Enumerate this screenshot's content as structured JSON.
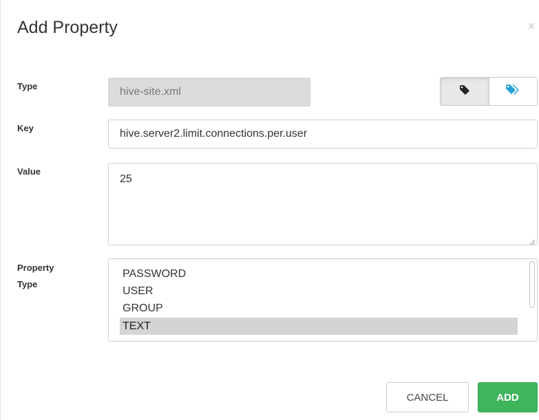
{
  "dialog": {
    "title": "Add Property",
    "close_glyph": "×"
  },
  "form": {
    "type": {
      "label": "Type",
      "value": "hive-site.xml"
    },
    "key": {
      "label": "Key",
      "value": "hive.server2.limit.connections.per.user"
    },
    "value": {
      "label": "Value",
      "value": "25"
    },
    "property_type": {
      "label_line1": "Property",
      "label_line2": "Type",
      "options": [
        "PASSWORD",
        "USER",
        "GROUP",
        "TEXT"
      ],
      "selected": "TEXT"
    }
  },
  "toggle": {
    "single_icon": "tag-icon",
    "multi_icon": "tags-icon",
    "active": "single"
  },
  "buttons": {
    "cancel": "CANCEL",
    "add": "ADD"
  },
  "colors": {
    "add_button": "#3fb55e",
    "tags_icon": "#2a9fd6",
    "selected_option": "#d4d4d4",
    "disabled_field": "#dcdcdc"
  }
}
